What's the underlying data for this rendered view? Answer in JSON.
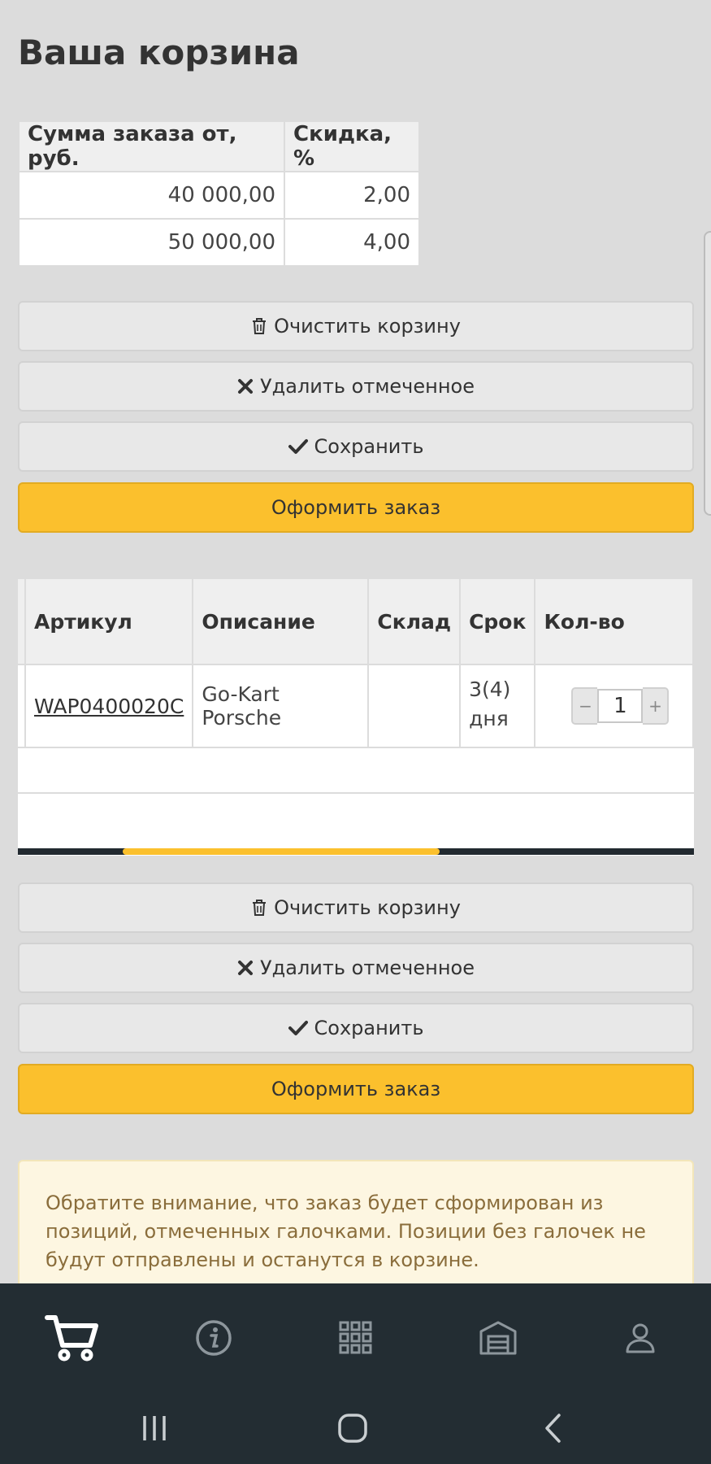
{
  "page": {
    "title": "Ваша корзина"
  },
  "discounts": {
    "headers": [
      "Сумма заказа от, руб.",
      "Скидка, %"
    ],
    "rows": [
      [
        "40 000,00",
        "2,00"
      ],
      [
        "50 000,00",
        "4,00"
      ]
    ]
  },
  "actions_top": {
    "clear": "Очистить корзину",
    "delete_selected": "Удалить отмеченное",
    "save": "Сохранить",
    "checkout": "Оформить заказ"
  },
  "items": {
    "headers": {
      "sku": "Артикул",
      "description": "Описание",
      "warehouse": "Склад",
      "term": "Срок",
      "qty": "Кол-во"
    },
    "rows": [
      {
        "sku": "WAP0400020C",
        "description": "Go-Kart Porsche",
        "warehouse": "",
        "term": "3(4) дня",
        "qty": "1"
      }
    ]
  },
  "actions_bottom": {
    "clear": "Очистить корзину",
    "delete_selected": "Удалить отмеченное",
    "save": "Сохранить",
    "checkout": "Оформить заказ"
  },
  "notice": {
    "text": "Обратите внимание, что заказ будет сформирован из позиций, отмеченных галочками. Позиции без галочек не будут отправлены и останутся в корзине."
  },
  "stepper": {
    "minus": "−",
    "plus": "+"
  },
  "nav": {
    "items": [
      "cart-icon",
      "info-icon",
      "catalog-grid-icon",
      "warehouse-icon",
      "user-icon"
    ],
    "active": "cart-icon"
  },
  "colors": {
    "accent": "#fbc02d",
    "nav_bg": "#232d33",
    "notice_bg": "#fdf6e1",
    "notice_text": "#8a6d3b"
  }
}
